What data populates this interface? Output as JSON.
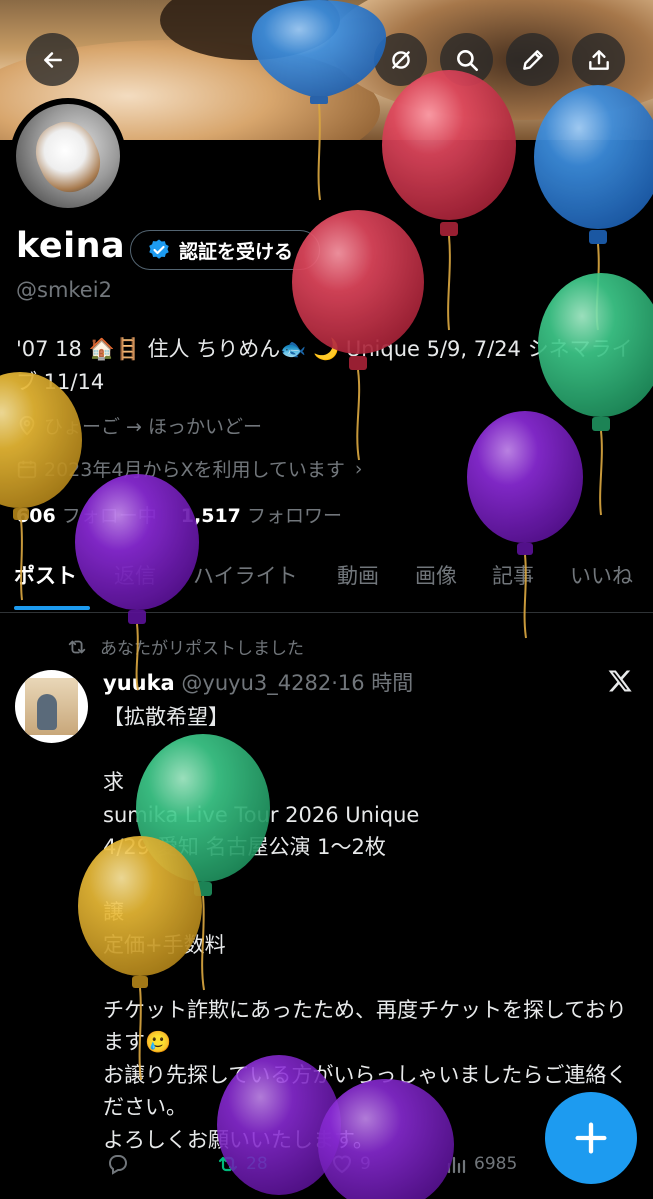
{
  "profile": {
    "name": "keina",
    "verify_label": "認証を受ける",
    "handle": "@smkei2",
    "bio": "'07 18 🏠🪜 住人 ちりめん🐟 🌙 Unique 5/9, 7/24 シネマライブ 11/14",
    "location": "ひょーご → ほっかいどー",
    "joined": "2023年4月からXを利用しています",
    "following_count": "606",
    "following_label": "フォロー中",
    "followers_count": "1,517",
    "followers_label": "フォロワー"
  },
  "tabs": [
    {
      "label": "ポスト",
      "active": true
    },
    {
      "label": "返信"
    },
    {
      "label": "ハイライト"
    },
    {
      "label": "動画"
    },
    {
      "label": "画像"
    },
    {
      "label": "記事"
    },
    {
      "label": "いいね"
    }
  ],
  "post": {
    "repost_note": "あなたがリポストしました",
    "author_name": "yuuka",
    "author_handle": "@yuyu3_4282",
    "time": "16 時間",
    "text": "【拡散希望】\n\n求\nsumika Live Tour 2026 Unique\n4/29 愛知 名古屋公演 1〜2枚\n\n譲\n定価+手数料\n\nチケット詐欺にあったため、再度チケットを探しております🥲\nお譲り先探している方がいらっしゃいましたらご連絡ください。\nよろしくお願いいたします。",
    "reposts": "28",
    "likes": "9",
    "views": "6985"
  },
  "colors": {
    "accent": "#1d9bf0",
    "repost_green": "#00ba7c",
    "secondary_text": "#71767b",
    "balloon_blue": "#3d8fe0",
    "balloon_red": "#e0475d",
    "balloon_green": "#3ec98a",
    "balloon_purple": "#8a2bd6",
    "balloon_yellow": "#e8b936"
  },
  "icons": [
    "back-arrow-icon",
    "no-sync-icon",
    "search-icon",
    "edit-pencil-icon",
    "share-icon",
    "verified-badge-icon",
    "location-icon",
    "calendar-icon",
    "repost-icon",
    "x-logo-icon",
    "reply-icon",
    "like-icon",
    "views-icon",
    "compose-plus-icon"
  ]
}
